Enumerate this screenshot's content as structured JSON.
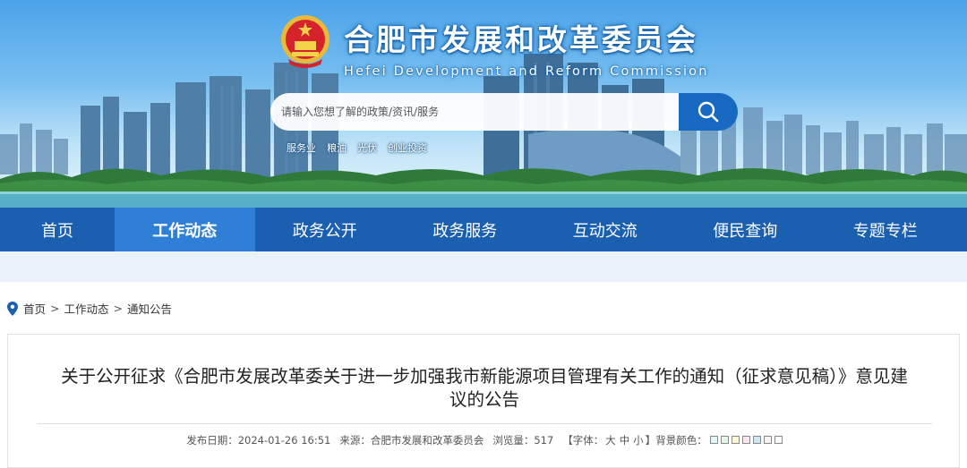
{
  "header": {
    "site_title": "合肥市发展和改革委员会",
    "site_subtitle": "Hefei Development and Reform Commission",
    "search_placeholder": "请输入您想了解的政策/资讯/服务",
    "hot_links": [
      "服务业",
      "粮油",
      "光伏",
      "创业投资"
    ]
  },
  "nav": {
    "items": [
      "首页",
      "工作动态",
      "政务公开",
      "政务服务",
      "互动交流",
      "便民查询",
      "专题专栏"
    ],
    "active": "工作动态"
  },
  "breadcrumb": [
    "首页",
    "工作动态",
    "通知公告"
  ],
  "breadcrumb_separator": ">",
  "article": {
    "title_line1": "关于公开征求《合肥市发展改革委关于进一步加强我市新能源项目管理有关工作的通知（征求意见稿）》意见建",
    "title_line2": "议的公告",
    "meta": {
      "date_label": "发布日期：",
      "date": "2024-01-26 16:51",
      "source_label": "来源：",
      "source": "合肥市发展和改革委员会",
      "views_label": "浏览量：",
      "views": "517",
      "font_label": "【字体：",
      "font_sizes": [
        "大",
        "中",
        "小"
      ],
      "font_close": "】",
      "bg_label": "背景颜色：",
      "bg_colors": [
        "#e8f6fc",
        "#e6f7e6",
        "#fdf8d8",
        "#f9e6ee",
        "#cfe6f7",
        "#f3f3f3",
        "#ffffff"
      ]
    }
  },
  "colors": {
    "nav_bg": "#1a5fb0",
    "nav_active": "#2f7fd6",
    "search_button": "#1769c2",
    "pin": "#1a5fb0"
  }
}
